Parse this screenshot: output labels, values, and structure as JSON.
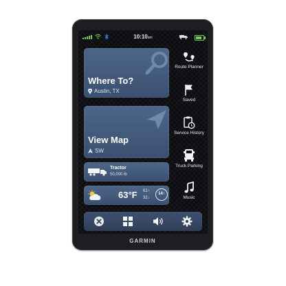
{
  "status": {
    "time": "10:10",
    "time_suffix": "am",
    "colors": {
      "signal": "#6fd04b",
      "bluetooth": "#3c8ef0",
      "battery": "#6fd04b"
    }
  },
  "cards": {
    "where_to": {
      "title": "Where To?",
      "location": "Austin, TX"
    },
    "view_map": {
      "title": "View Map",
      "heading": "SW"
    },
    "vehicle": {
      "name": "Tractor",
      "weight": "50,000 lb"
    },
    "weather": {
      "temp": "63°F",
      "high": "61↑",
      "low": "32↓",
      "speed_limit": "14↑"
    }
  },
  "rail": [
    {
      "label": "Route Planner",
      "icon": "route-planner-icon"
    },
    {
      "label": "Saved",
      "icon": "flag-icon"
    },
    {
      "label": "Service History",
      "icon": "service-history-icon"
    },
    {
      "label": "Truck Parking",
      "icon": "truck-parking-icon"
    },
    {
      "label": "Music",
      "icon": "music-note-icon"
    }
  ],
  "bottom_bar": [
    "close-icon",
    "apps-grid-icon",
    "volume-icon",
    "settings-gear-icon"
  ],
  "brand": "GARMIN",
  "theme": {
    "card": "#4d6687",
    "card_dark": "#3a5070",
    "bezel": "#1d1e22"
  }
}
